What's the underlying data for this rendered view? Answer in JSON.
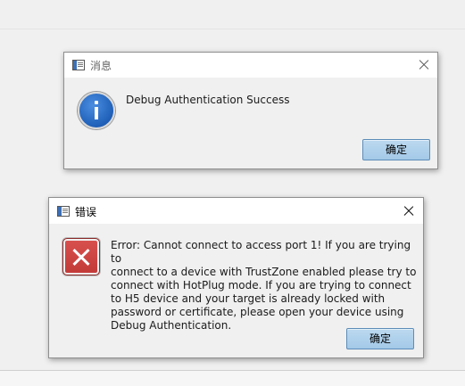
{
  "info_dialog": {
    "title": "消息",
    "message": "Debug Authentication Success",
    "ok_label": "确定"
  },
  "error_dialog": {
    "title": "错误",
    "message_lines": [
      "Error: Cannot connect to access port 1!  If you are trying to",
      "connect to a device with TrustZone enabled please try to",
      "connect with HotPlug mode.  If you are trying to connect",
      "to H5 device and your target is already locked with",
      "password or certificate, please open your device using",
      "Debug Authentication."
    ],
    "ok_label": "确定"
  },
  "icons": {
    "info": "info-icon",
    "error": "error-icon",
    "window": "window-app-icon",
    "close": "close-icon"
  },
  "colors": {
    "info_blue": "#1f5fb8",
    "error_red": "#c23a38",
    "button_blue": "#a3c9e8"
  }
}
